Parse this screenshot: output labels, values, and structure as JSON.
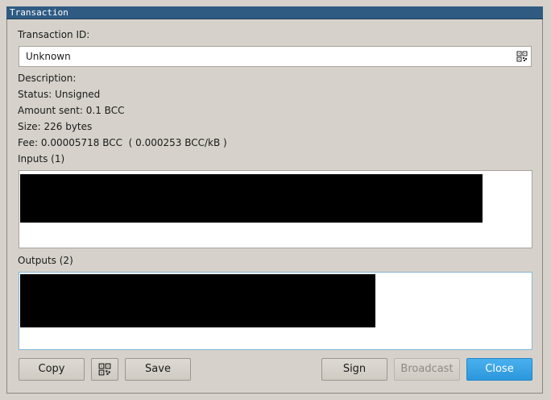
{
  "window": {
    "title": "Transaction"
  },
  "transaction": {
    "id_label": "Transaction ID:",
    "id_value": "Unknown",
    "description": "Description:",
    "status": "Status: Unsigned",
    "amount": "Amount sent: 0.1 BCC",
    "size": "Size: 226 bytes",
    "fee": "Fee: 0.00005718 BCC  ( 0.000253 BCC/kB )"
  },
  "inputs": {
    "label": "Inputs (1)"
  },
  "outputs": {
    "label": "Outputs (2)"
  },
  "buttons": {
    "copy": "Copy",
    "save": "Save",
    "sign": "Sign",
    "broadcast": "Broadcast",
    "close": "Close"
  },
  "icons": {
    "qr": "qr-code-icon"
  },
  "colors": {
    "accent": "#2b97dc",
    "titlebar": "#2f5b83"
  }
}
